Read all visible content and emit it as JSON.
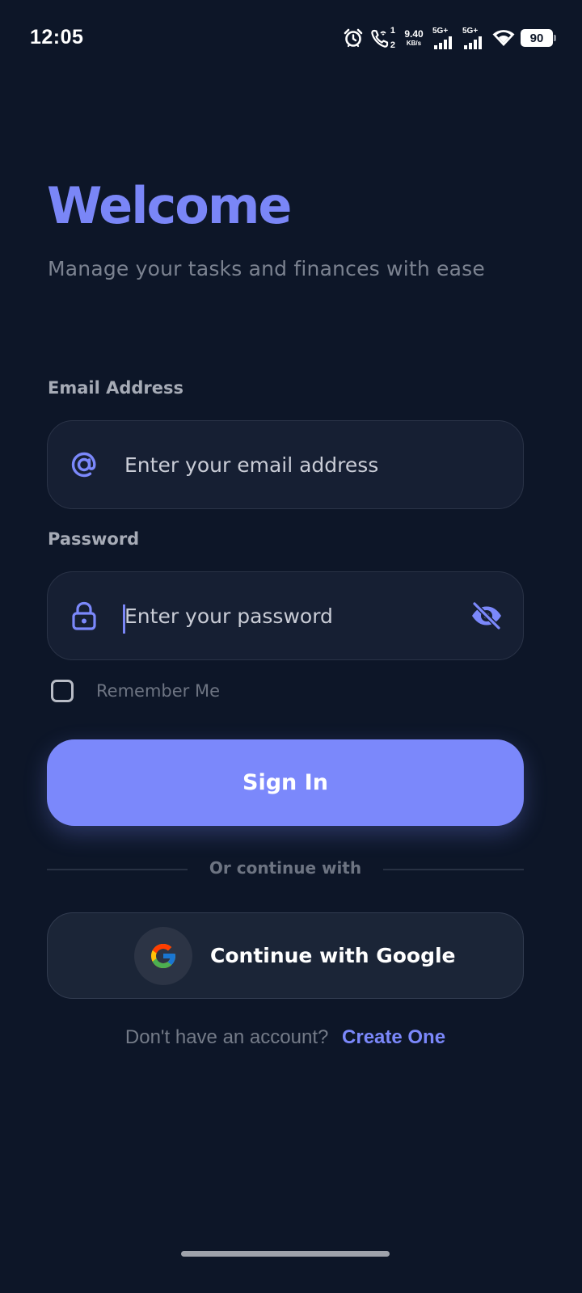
{
  "status_bar": {
    "time": "12:05",
    "call_sim": "1",
    "call_sim_2": "2",
    "net_speed_value": "9.40",
    "net_speed_unit": "KB/s",
    "sim1_network": "5G+",
    "sim2_network": "5G+",
    "battery_level": "90",
    "icons": [
      "alarm-icon",
      "wifi-calling-icon",
      "signal-icon",
      "signal-icon",
      "wifi-icon",
      "battery-icon"
    ]
  },
  "header": {
    "title": "Welcome",
    "subtitle": "Manage your tasks and finances with ease"
  },
  "form": {
    "email": {
      "label": "Email Address",
      "placeholder": "Enter your email address",
      "value": "",
      "icon": "at-icon"
    },
    "password": {
      "label": "Password",
      "placeholder": "Enter your password",
      "value": "",
      "icon": "lock-icon",
      "toggle_icon": "eye-off-icon"
    },
    "remember_me": {
      "label": "Remember Me",
      "checked": false
    },
    "submit_label": "Sign In"
  },
  "divider_text": "Or continue with",
  "google_button": {
    "label": "Continue with Google",
    "icon": "google-icon"
  },
  "signup": {
    "prompt": "Don't have an account?",
    "link_label": "Create One"
  },
  "colors": {
    "background": "#0d1628",
    "accent": "#7b88fb",
    "input_bg": "#161f33",
    "muted_text": "#7b8290"
  }
}
